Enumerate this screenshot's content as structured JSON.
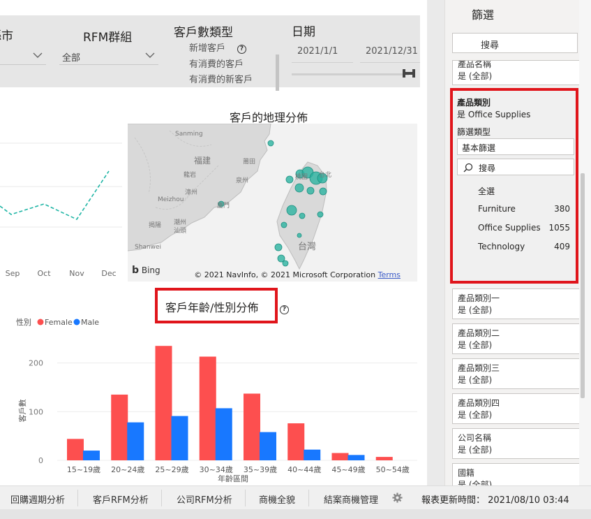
{
  "slicers": {
    "city": {
      "title": "縣市",
      "value": ""
    },
    "rfm": {
      "title": "RFM群組",
      "value": "全部"
    },
    "customer_type": {
      "title": "客戶數類型",
      "options": [
        "新增客戶",
        "有消費的客戶",
        "有消費的新客戶"
      ]
    },
    "date": {
      "title": "日期",
      "start": "2021/1/1",
      "end": "2021/12/31"
    }
  },
  "line_chart": {
    "x_labels": [
      "Sep",
      "Oct",
      "Nov",
      "Dec"
    ],
    "color": "#1fb5a5"
  },
  "map": {
    "title": "客戶的地理分佈",
    "places": [
      "Sanming",
      "福建",
      "莆田",
      "龍岩",
      "泉州",
      "漳州",
      "Meizhou",
      "廈門",
      "揭陽",
      "潮州",
      "汕頭",
      "Shanwei",
      "桃園",
      "台北",
      "台灣"
    ],
    "bing_label": "Bing",
    "copyright": "© 2021 NavInfo, © 2021 Microsoft Corporation",
    "terms_label": "Terms",
    "bubble_color": "#2ab3a0"
  },
  "age_chart": {
    "title": "客戶年齡/性別分佈",
    "legend_title": "性別",
    "female_color": "#fd4f4f",
    "male_color": "#1878ff"
  },
  "chart_data": {
    "type": "bar",
    "categories": [
      "15~19歲",
      "20~24歲",
      "25~29歲",
      "30~34歲",
      "35~39歲",
      "40~44歲",
      "45~49歲",
      "50~54歲"
    ],
    "series": [
      {
        "name": "Female",
        "values": [
          44,
          135,
          235,
          213,
          137,
          76,
          15,
          7
        ]
      },
      {
        "name": "Male",
        "values": [
          20,
          78,
          91,
          107,
          58,
          22,
          11,
          0
        ]
      }
    ],
    "xlabel": "年齡區間",
    "ylabel": "客戶數",
    "y_ticks": [
      0,
      100,
      200
    ],
    "ylim": [
      0,
      240
    ],
    "legend": "top-left",
    "grid": true
  },
  "filters": {
    "title": "篩選",
    "search_placeholder": "搜尋",
    "top_card": {
      "name": "產品名稱",
      "value": "是 (全部)"
    },
    "expanded": {
      "name": "產品類別",
      "value": "是 Office Supplies",
      "type_label": "篩選類型",
      "type_value": "基本篩選",
      "search_placeholder": "搜尋",
      "select_all": "全選",
      "options": [
        {
          "label": "Furniture",
          "count": "380"
        },
        {
          "label": "Office Supplies",
          "count": "1055"
        },
        {
          "label": "Technology",
          "count": "409"
        }
      ]
    },
    "cards": [
      {
        "name": "產品類別一",
        "value": "是 (全部)"
      },
      {
        "name": "產品類別二",
        "value": "是 (全部)"
      },
      {
        "name": "產品類別三",
        "value": "是 (全部)"
      },
      {
        "name": "產品類別四",
        "value": "是 (全部)"
      },
      {
        "name": "公司名稱",
        "value": "是 (全部)"
      },
      {
        "name": "國籍",
        "value": "是 (全部)"
      }
    ]
  },
  "tabs": [
    "回購週期分析",
    "客戶RFM分析",
    "公司RFM分析",
    "商機全貌",
    "結案商機管理"
  ],
  "update_time": "報表更新時間： 2021/08/10 03:44"
}
